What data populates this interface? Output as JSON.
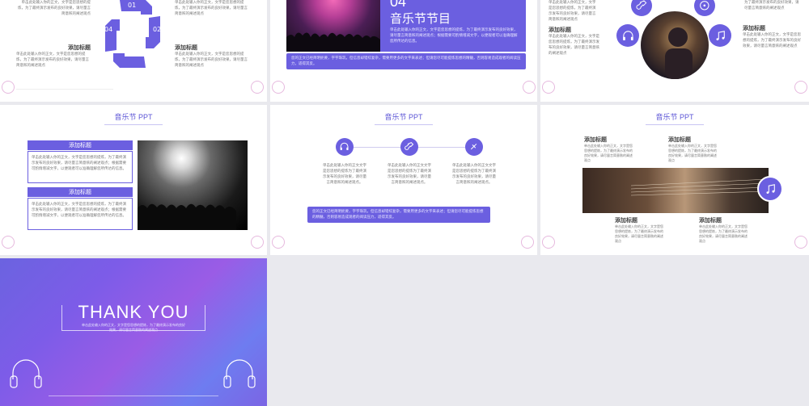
{
  "colors": {
    "accent": "#6b5fe0",
    "title": "#5b54d6"
  },
  "s1": {
    "steps": [
      "01",
      "02",
      "03",
      "04"
    ],
    "tl_text": "单击此处输入你的正文，文字是您思想的提炼，为了最终演示发布的良好效果，请尽量言简意赅的阐述观点",
    "tr_text": "单击此处输入你的正文，文字是您思想的提炼，为了最终演示发布的良好效果，请尽量言简意赅的阐述观点",
    "bl_head": "添加标题",
    "bl_text": "单击此处输入你的正文，文字是您思想的提炼，为了最终演示发布的良好效果，请尽量言简意赅的阐述观点",
    "br_head": "添加标题",
    "br_text": "单击此处输入你的正文，文字是您思想的提炼，为了最终演示发布的良好效果，请尽量言简意赅的阐述观点"
  },
  "s2": {
    "number": "04",
    "title": "音乐节节目",
    "desc": "单击此处输入你的正文，文字是您思想的提炼，为了最终演示发布的良好效果，请尽量言简意赅的阐述观点；根据需要可酌情增减文字，以便观者可以准确理解您所传达的信息。",
    "bar": "您的正文已经简明扼要，字字珠玑，但信息却错综复杂，需要用更多的文字来表述；但请您尽可能提炼思想的精髓，否则容易造成观者的阅读压力，适得其反。"
  },
  "s3": {
    "top_text": "单击此处输入你的正文，文字是您思想的提炼，为了最终演示发布的良好效果，请尽量言简意赅的阐述观点",
    "right_top_text": "为了最终演示发布的良好效果，请尽量言简意赅的阐述观点",
    "l_head": "添加标题",
    "l_text": "单击此处输入你的正文，文字是您思想的提炼，为了最终演示发布的良好效果，请尽量言简意赅的阐述观点",
    "r_head": "添加标题",
    "r_text": "单击此处输入你的正文，文字是您思想的提炼，为了最终演示发布的良好效果，请尽量言简意赅的阐述观点"
  },
  "s4": {
    "title": "音乐节 PPT",
    "box1_head": "添加标题",
    "box1_text": "单击此处输入你的正文，文字是您思想的提炼，为了最终演示发布的良好效果，请尽量言简意赅的阐述观点；根据需要可酌情增减文字，以便观者可以准确理解您所传达的信息。",
    "box2_head": "添加标题",
    "box2_text": "单击此处输入你的正文，文字是您思想的提炼，为了最终演示发布的良好效果，请尽量言简意赅的阐述观点；根据需要可酌情增减文字，以便观者可以准确理解您所传达的信息。"
  },
  "s5": {
    "title": "音乐节 PPT",
    "col1": "单击此处输入你的正文文字是您思想的提炼为了最终演示发布的良好效果，请尽量言简意赅的阐述观点。",
    "col2": "单击此处输入你的正文文字是您思想的提炼为了最终演示发布的良好效果，请尽量言简意赅的阐述观点。",
    "col3": "单击此处输入你的正文文字是您思想的提炼为了最终演示发布的良好效果，请尽量言简意赅的阐述观点。",
    "bar": "您的正文已经简明扼要，字字珠玑，但信息却错综复杂，需要用更多的文字来表述；但请您尽可能提炼思想的精髓，否则容易造成观者的阅读压力，适得其反。"
  },
  "s6": {
    "title": "音乐节 PPT",
    "h1": "添加标题",
    "t1": "单击此处输入你的正文，文字是您思想的提炼，为了最终演示发布的良好效果，请尽量言简意赅的阐述观点",
    "h2": "添加标题",
    "t2": "单击此处输入你的正文，文字是您思想的提炼，为了最终演示发布的良好效果，请尽量言简意赅的阐述观点",
    "h3": "添加标题",
    "t3": "单击此处输入你的正文，文字是您思想的提炼，为了最终演示发布的良好效果，请尽量言简意赅的阐述观点",
    "h4": "添加标题",
    "t4": "单击此处输入你的正文，文字是您思想的提炼，为了最终演示发布的良好效果，请尽量言简意赅的阐述观点"
  },
  "s7": {
    "title": "THANK YOU",
    "sub": "单击此处输入你的正文，文字是您思想的提炼，为了最终演示发布的良好效果，请尽量言简意赅的阐述观点"
  }
}
